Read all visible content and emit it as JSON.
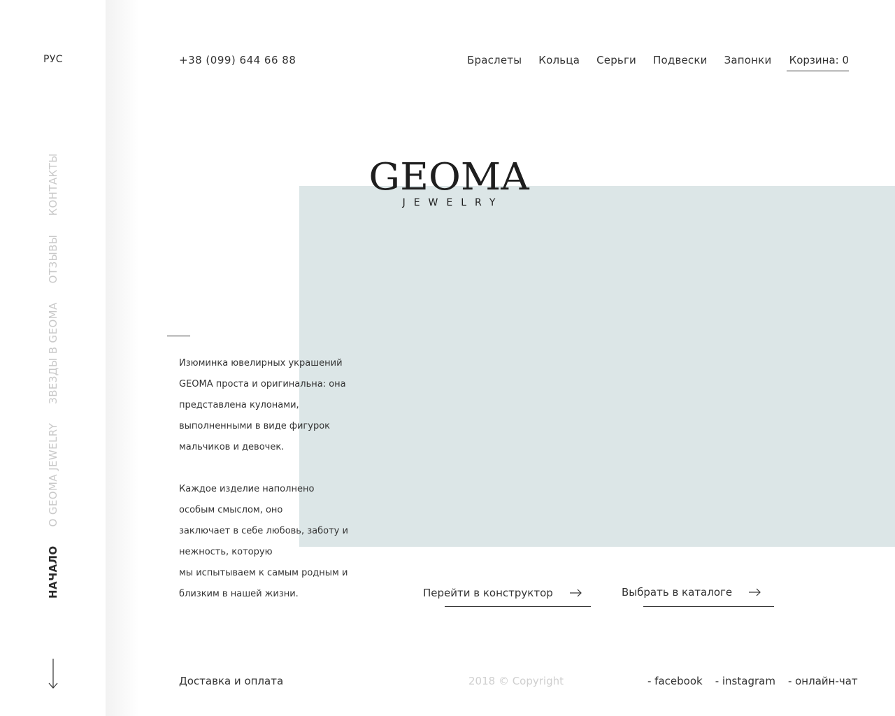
{
  "sidebar": {
    "lang": "РУС",
    "nav": [
      {
        "label": "НАЧАЛО",
        "active": true
      },
      {
        "label": "О GEOMA JEWELRY",
        "active": false
      },
      {
        "label": "ЗВЕЗДЫ В GEOMA",
        "active": false
      },
      {
        "label": "ОТЗЫВЫ",
        "active": false
      },
      {
        "label": "КОНТАКТЫ",
        "active": false
      }
    ],
    "scroll_icon": "arrow-down-icon"
  },
  "header": {
    "phone": "+38 (099) 644 66 88",
    "nav": [
      "Браслеты",
      "Кольца",
      "Серьги",
      "Подвески",
      "Запонки"
    ],
    "cart": "Корзина: 0"
  },
  "hero": {
    "logo_main": "GEOMA",
    "logo_sub": "JEWELRY",
    "description": [
      "Изюминка ювелирных украшений\nGEOMA проста и оригинальна: она\nпредставлена кулонами,\nвыполненными в виде фигурок\nмальчиков и девочек.",
      "Каждое изделие наполнено\nособым смыслом, оно\nзаключает в себе любовь, заботу и\nнежность, которую\nмы испытываем к самым родным и\nблизким в нашей жизни."
    ],
    "buttons": {
      "constructor": "Перейти в конструктор",
      "catalog": "Выбрать в каталоге"
    },
    "accent_color": "#dce6e7"
  },
  "footer": {
    "delivery": "Доставка и оплата",
    "copyright": "2018 © Copyright",
    "social": [
      "- facebook",
      "- instagram",
      "- онлайн-чат"
    ]
  }
}
